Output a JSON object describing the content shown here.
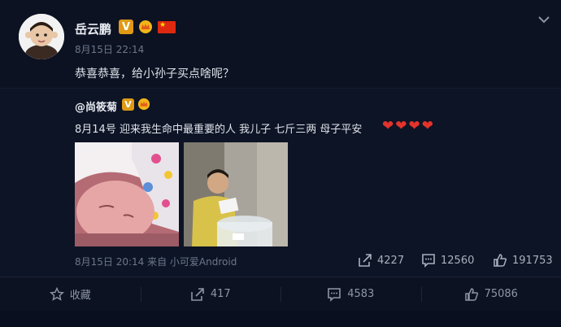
{
  "post": {
    "author": "岳云鹏",
    "time": "8月15日 22:14",
    "text": "恭喜恭喜，给小孙子买点啥呢？"
  },
  "repost": {
    "author": "@尚筱菊",
    "text": "8月14号 迎来我生命中最重要的人 我儿子 七斤三两 母子平安",
    "meta": "8月15日 20:14 来自 小可爱Android",
    "share_count": "4227",
    "comment_count": "12560",
    "like_count": "191753"
  },
  "actions": {
    "favorite_label": "收藏",
    "share_count": "417",
    "comment_count": "4583",
    "like_count": "75086"
  },
  "colors": {
    "background": "#0c1222",
    "verified_badge": "#e09a15",
    "heart": "#e4332b"
  },
  "icons": [
    "chevron-down-icon",
    "verified-icon",
    "crown-icon",
    "flag-icon",
    "share-icon",
    "comment-icon",
    "like-icon",
    "star-icon",
    "heart-icon"
  ]
}
